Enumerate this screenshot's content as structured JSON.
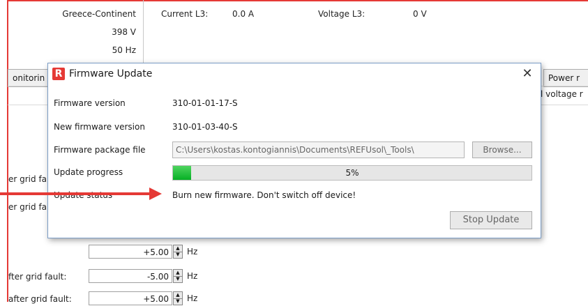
{
  "background": {
    "grid_region": "Greece-Continent",
    "voltage": "398 V",
    "frequency": "50 Hz",
    "current_l3_label": "Current L3:",
    "current_l3_value": "0.0 A",
    "voltage_l3_label": "Voltage L3:",
    "voltage_l3_value": "0 V",
    "tab_monitoring": "onitorin",
    "tab_power": "Power r",
    "voltage_tab_text": "l voltage r",
    "side_label_1": "er grid fa",
    "side_label_2": "er grid fa",
    "row1_value": "+5.00",
    "row1_unit": "Hz",
    "row2_label": "fter grid fault:",
    "row2_value": "-5.00",
    "row2_unit": "Hz",
    "row3_label": "after grid fault:",
    "row3_value": "+5.00",
    "row3_unit": "Hz"
  },
  "dialog": {
    "title": "Firmware Update",
    "logo_letter": "R",
    "close_glyph": "✕",
    "rows": {
      "firmware_version_label": "Firmware version",
      "firmware_version_value": "310-01-01-17-S",
      "new_firmware_version_label": "New firmware version",
      "new_firmware_version_value": "310-01-03-40-S",
      "package_file_label": "Firmware package file",
      "package_file_value": "C:\\Users\\kostas.kontogiannis\\Documents\\REFUsol\\_Tools\\",
      "browse_label": "Browse...",
      "update_progress_label": "Update progress",
      "update_progress_percent": 5,
      "update_progress_text": "5%",
      "update_status_label": "Update status",
      "update_status_value": "Burn new firmware. Don't switch off device!"
    },
    "stop_button_label": "Stop Update"
  },
  "colors": {
    "accent_red": "#e53935",
    "progress_green": "#06b025"
  },
  "icons": {
    "logo": "refusol-logo-icon",
    "close": "close-icon",
    "spin": "spin-arrows-icon",
    "annotation": "arrow-annotation"
  }
}
